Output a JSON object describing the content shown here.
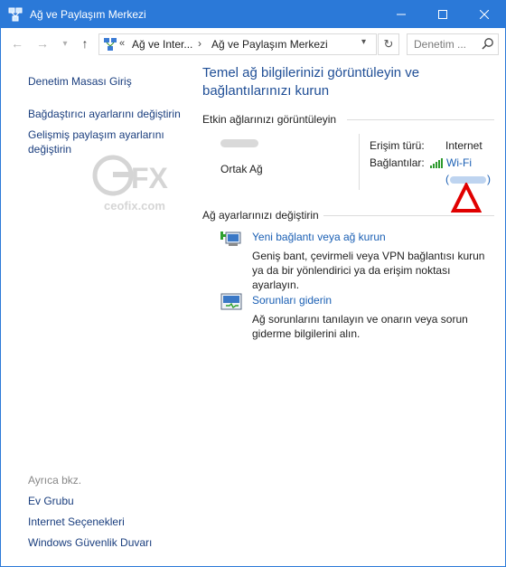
{
  "window": {
    "title": "Ağ ve Paylaşım Merkezi"
  },
  "address": {
    "prefix": "«",
    "crumb1": "Ağ ve Inter...",
    "crumb2": "Ağ ve Paylaşım Merkezi",
    "search_placeholder": "Denetim ..."
  },
  "sidebar": {
    "home": "Denetim Masası Giriş",
    "adapter": "Bağdaştırıcı ayarlarını değiştirin",
    "sharing": "Gelişmiş paylaşım ayarlarını değiştirin",
    "see_also": "Ayrıca bkz.",
    "see_also_items": [
      "Ev Grubu",
      "Internet Seçenekleri",
      "Windows Güvenlik Duvarı"
    ]
  },
  "watermark": {
    "logo": "GFX",
    "site": "ceofix.com"
  },
  "main": {
    "heading": "Temel ağ bilgilerinizi görüntüleyin ve bağlantılarınızı kurun",
    "active_networks_title": "Etkin ağlarınızı görüntüleyin",
    "network_type": "Ortak Ağ",
    "access_label": "Erişim türü:",
    "access_value": "Internet",
    "connections_label": "Bağlantılar:",
    "connection_name": "Wi-Fi",
    "change_title": "Ağ ayarlarınızı değiştirin",
    "tasks": [
      {
        "title": "Yeni bağlantı veya ağ kurun",
        "desc": "Geniş bant, çevirmeli veya VPN bağlantısı kurun ya da bir yönlendirici ya da erişim noktası ayarlayın.",
        "icon": "new-connection-icon"
      },
      {
        "title": "Sorunları giderin",
        "desc": "Ağ sorunlarını tanılayın ve onarın veya sorun giderme bilgilerini alın.",
        "icon": "troubleshoot-icon"
      }
    ]
  },
  "colors": {
    "titlebar": "#2b79d8",
    "link": "#1a5fb4",
    "heading": "#1f4e96",
    "annotation": "#e00000"
  }
}
